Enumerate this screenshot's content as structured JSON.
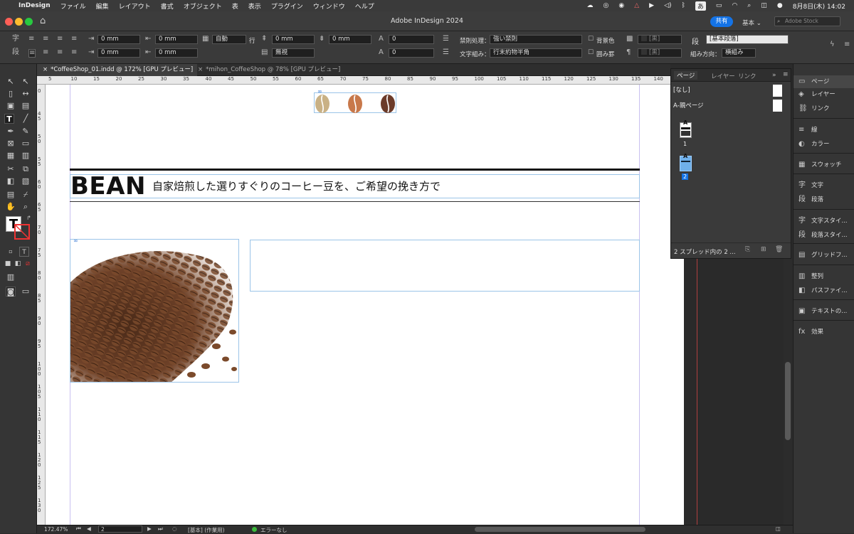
{
  "menubar": {
    "app_name": "InDesign",
    "items": [
      "ファイル",
      "編集",
      "レイアウト",
      "書式",
      "オブジェクト",
      "表",
      "表示",
      "プラグイン",
      "ウィンドウ",
      "ヘルプ"
    ],
    "ime": "あ",
    "clock": "8月8日(木) 14:02"
  },
  "window": {
    "title": "Adobe InDesign 2024",
    "share_label": "共有",
    "workspace": "基本",
    "stock_placeholder": "Adobe Stock"
  },
  "control": {
    "indent_left": "0 mm",
    "indent_first": "0 mm",
    "indent_right": "0 mm",
    "indent_last": "0 mm",
    "leading": "自動",
    "line_label": "行",
    "space_before": "0 mm",
    "space_after": "0 mm",
    "none_label": "無視",
    "dropcap_lines": "0",
    "dropcap_chars": "0",
    "kinsoku_label": "禁則処理：",
    "kinsoku_value": "強い禁則",
    "mojikumi_label": "文字組み：",
    "mojikumi_value": "行末約物半角",
    "bg_color_label": "背景色",
    "border_label": "囲み罫",
    "swatch1": "[黒]",
    "swatch2": "[黒]",
    "para_style_label": "段",
    "para_style": "[基本段落]",
    "direction_label": "組み方向：",
    "direction_value": "横組み"
  },
  "tabs": [
    {
      "label": "*CoffeeShop_01.indd @ 172% [GPU プレビュー]",
      "close": "×"
    },
    {
      "label": "*mihon_CoffeeShop @ 78% [GPU プレビュー]",
      "close": "×"
    }
  ],
  "ruler_h": [
    "5",
    "10",
    "15",
    "20",
    "25",
    "30",
    "35",
    "40",
    "45",
    "50",
    "55",
    "60",
    "65",
    "70",
    "75",
    "80",
    "85",
    "90",
    "95",
    "100",
    "105",
    "110",
    "115",
    "120",
    "125",
    "130",
    "135",
    "140"
  ],
  "ruler_v": [
    "0",
    "4 5",
    "5 0",
    "5 5",
    "6 0",
    "6 5",
    "7 0",
    "7 5",
    "8 0",
    "8 5",
    "9 0",
    "9 5",
    "1 0 0",
    "1 0 5",
    "1 1 0",
    "1 1 5",
    "1 2 0",
    "1 2 5",
    "1 3 0"
  ],
  "document": {
    "heading_en": "BEAN",
    "heading_jp": "自家焙煎した選りすぐりのコーヒー豆を、ご希望の挽き方で"
  },
  "pages_panel": {
    "tabs": [
      "ページ",
      "レイヤー",
      "リンク"
    ],
    "none_label": "[なし]",
    "master_label": "A-親ページ",
    "page1": "1",
    "page2": "2",
    "thumb_letter": "A",
    "footer": "2 スプレッド内の 2 ..."
  },
  "right_panel": [
    {
      "icon": "page-icon",
      "glyph": "▭",
      "label": "ページ"
    },
    {
      "icon": "layers-icon",
      "glyph": "◈",
      "label": "レイヤー"
    },
    {
      "icon": "link-icon",
      "glyph": "⛓",
      "label": "リンク"
    },
    {
      "icon": "stroke-icon",
      "glyph": "≡",
      "label": "線"
    },
    {
      "icon": "color-icon",
      "glyph": "◐",
      "label": "カラー"
    },
    {
      "icon": "swatch-icon",
      "glyph": "▦",
      "label": "スウォッチ"
    },
    {
      "icon": "character-icon",
      "glyph": "字",
      "label": "文字"
    },
    {
      "icon": "paragraph-icon",
      "glyph": "段",
      "label": "段落"
    },
    {
      "icon": "char-style-icon",
      "glyph": "字",
      "label": "文字スタイ..."
    },
    {
      "icon": "para-style-icon",
      "glyph": "段",
      "label": "段落スタイ..."
    },
    {
      "icon": "grid-icon",
      "glyph": "▤",
      "label": "グリッドフ..."
    },
    {
      "icon": "align-icon",
      "glyph": "▥",
      "label": "整列"
    },
    {
      "icon": "pathfinder-icon",
      "glyph": "◧",
      "label": "パスファイ..."
    },
    {
      "icon": "text-wrap-icon",
      "glyph": "▣",
      "label": "テキストの..."
    },
    {
      "icon": "effects-icon",
      "glyph": "fx",
      "label": "効果"
    }
  ],
  "statusbar": {
    "zoom": "172.47%",
    "page": "2",
    "master": "[基本] (作業用)",
    "preflight": "エラーなし"
  },
  "colors": {
    "accent_blue": "#1473e6",
    "frame_blue": "#9bc4e8",
    "bean_light": "#c9b185",
    "bean_orange": "#c8784a",
    "bean_dark": "#6b3b2a",
    "status_ok": "#3cba3c"
  }
}
